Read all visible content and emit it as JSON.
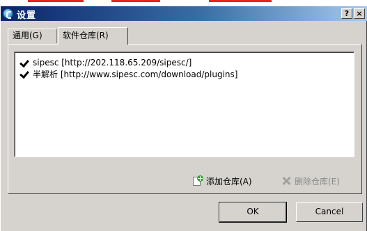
{
  "window": {
    "title": "设置",
    "help_label": "?",
    "close_label": "×"
  },
  "tabs": [
    {
      "label": "通用(G)",
      "active": false
    },
    {
      "label": "软件仓库(R)",
      "active": true
    }
  ],
  "repositories": [
    {
      "checked": true,
      "text": "sipesc [http://202.118.65.209/sipesc/]"
    },
    {
      "checked": true,
      "text": "半解析 [http://www.sipesc.com/download/plugins]"
    }
  ],
  "actions": {
    "add_label": "添加仓库(A)",
    "delete_label": "删除仓库(E)",
    "delete_enabled": false
  },
  "buttons": {
    "ok_label": "OK",
    "cancel_label": "Cancel"
  },
  "colors": {
    "titlebar_start": "#0a246a",
    "titlebar_end": "#a6caf0",
    "face": "#d6d3ce",
    "accent_red": "#e8261b"
  }
}
